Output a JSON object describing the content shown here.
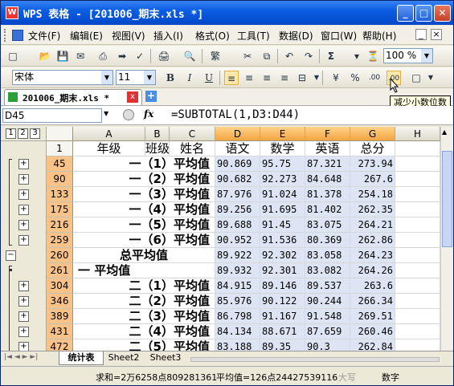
{
  "window": {
    "app_icon": "W",
    "title": "WPS 表格 - [201006_期末.xls *]",
    "btn_min": "_",
    "btn_max": "□",
    "btn_close": "✕"
  },
  "menu": {
    "items": [
      "文件(F)",
      "编辑(E)",
      "视图(V)",
      "插入(I)",
      "格式(O)",
      "工具(T)",
      "数据(D)",
      "窗口(W)",
      "帮助(H)"
    ],
    "min": "_",
    "close": "×"
  },
  "toolbar": {
    "zoom": "100 %",
    "glyphs": [
      "□",
      "📂",
      "💾",
      "✉",
      "⎙",
      "➡",
      "✓",
      "🖨",
      "🔍",
      "繁",
      "✂",
      "⧉",
      "↶",
      "↷",
      "Σ",
      "▾",
      "⏳"
    ]
  },
  "format_toolbar": {
    "font_name": "宋体",
    "font_size": "11",
    "bold": "B",
    "italic": "I",
    "underline": "U",
    "percent": "%",
    "comma": "%",
    "inc_decimal": ".00",
    "dec_decimal": ".00"
  },
  "tab": {
    "doc_name": "201006_期末.xls *",
    "close": "x",
    "add": "+"
  },
  "formula": {
    "cell_ref": "D45",
    "fx": "fx",
    "content": "=SUBTOTAL(1,D3:D44)"
  },
  "tooltip": "减少小数位数",
  "outline_levels": [
    "1",
    "2",
    "3"
  ],
  "columns": [
    "A",
    "B",
    "C",
    "D",
    "E",
    "F",
    "G",
    "H"
  ],
  "headers": {
    "A": "年级",
    "B": "班级",
    "C": "姓名",
    "D": "语文",
    "E": "数学",
    "F": "英语",
    "G": "总分"
  },
  "rows": [
    {
      "row": "1",
      "type": "header"
    },
    {
      "row": "45",
      "label": "一（1）平均值",
      "d": "90.869",
      "e": "95.75",
      "f": "87.321",
      "g": "273.94"
    },
    {
      "row": "90",
      "label": "一（2）平均值",
      "d": "90.682",
      "e": "92.273",
      "f": "84.648",
      "g": "267.6"
    },
    {
      "row": "133",
      "label": "一（3）平均值",
      "d": "87.976",
      "e": "91.024",
      "f": "81.378",
      "g": "254.18"
    },
    {
      "row": "175",
      "label": "一（4）平均值",
      "d": "89.256",
      "e": "91.695",
      "f": "81.402",
      "g": "262.35"
    },
    {
      "row": "216",
      "label": "一（5）平均值",
      "d": "89.688",
      "e": "91.45",
      "f": "83.075",
      "g": "264.21"
    },
    {
      "row": "259",
      "label": "一（6）平均值",
      "d": "90.952",
      "e": "91.536",
      "f": "80.369",
      "g": "262.86"
    },
    {
      "row": "260",
      "label": "总平均值",
      "d": "89.922",
      "e": "92.302",
      "f": "83.058",
      "g": "264.23"
    },
    {
      "row": "261",
      "label": "一 平均值",
      "d": "89.932",
      "e": "92.301",
      "f": "83.082",
      "g": "264.26"
    },
    {
      "row": "304",
      "label": "二（1）平均值",
      "d": "84.915",
      "e": "89.146",
      "f": "89.537",
      "g": "263.6"
    },
    {
      "row": "346",
      "label": "二（2）平均值",
      "d": "85.976",
      "e": "90.122",
      "f": "90.244",
      "g": "266.34"
    },
    {
      "row": "389",
      "label": "二（3）平均值",
      "d": "86.798",
      "e": "91.167",
      "f": "91.548",
      "g": "269.51"
    },
    {
      "row": "431",
      "label": "二（4）平均值",
      "d": "84.134",
      "e": "88.671",
      "f": "87.659",
      "g": "260.46"
    },
    {
      "row": "472",
      "label": "二（5）平均值",
      "d": "83.188",
      "e": "89.35",
      "f": "90.3",
      "g": "262.84"
    }
  ],
  "sheets": [
    "统计表",
    "Sheet2",
    "Sheet3"
  ],
  "status": {
    "sum": "求和=2万6258点809281361",
    "avg": "平均值=126点24427539116",
    "caps": "大写",
    "num": "数字"
  }
}
